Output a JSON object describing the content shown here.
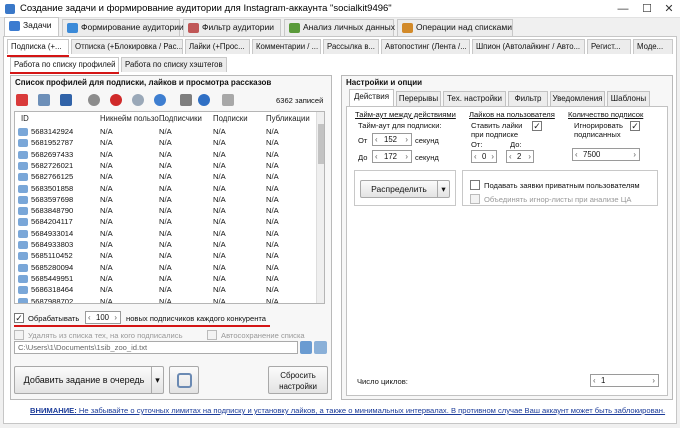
{
  "window": {
    "title": "Создание задачи и формирование аудитории для Instagram-аккаунта \"socialkit9496\"",
    "minimize": "—",
    "maximize": "☐",
    "close": "✕"
  },
  "main_tabs": [
    {
      "label": "Задачи",
      "icon": "tasks-icon",
      "color": "#3b7bd0"
    },
    {
      "label": "Формирование аудитории",
      "icon": "audience-icon",
      "color": "#3b8ad8"
    },
    {
      "label": "Фильтр аудитории",
      "icon": "filter-icon",
      "color": "#c05757"
    },
    {
      "label": "Анализ личных данных",
      "icon": "analysis-icon",
      "color": "#5a9a3a"
    },
    {
      "label": "Операции над списками",
      "icon": "lists-icon",
      "color": "#d28a2a"
    }
  ],
  "sub_tabs": [
    "Подписка (+...",
    "Отписка (+Блокировка / Рас...",
    "Лайки (+Прос...",
    "Комментарии / ...",
    "Рассылка в...",
    "Автопостинг (Лента /...",
    "Шпион (Автолайкинг / Авто...",
    "Регист...",
    "Моде..."
  ],
  "third_tabs": [
    "Работа по списку профилей",
    "Работа по списку хэштегов"
  ],
  "left": {
    "title": "Список профилей для подписки, лайков и просмотра рассказов",
    "count": "6362 записей",
    "columns": [
      "ID",
      "Никнейм пользо...",
      "Подписчики",
      "Подписки",
      "Публикации"
    ],
    "rows": [
      [
        "5683142924",
        "N/A",
        "N/A",
        "N/A",
        "N/A"
      ],
      [
        "5681952787",
        "N/A",
        "N/A",
        "N/A",
        "N/A"
      ],
      [
        "5682697433",
        "N/A",
        "N/A",
        "N/A",
        "N/A"
      ],
      [
        "5682726021",
        "N/A",
        "N/A",
        "N/A",
        "N/A"
      ],
      [
        "5682766125",
        "N/A",
        "N/A",
        "N/A",
        "N/A"
      ],
      [
        "5683501858",
        "N/A",
        "N/A",
        "N/A",
        "N/A"
      ],
      [
        "5683597698",
        "N/A",
        "N/A",
        "N/A",
        "N/A"
      ],
      [
        "5683848790",
        "N/A",
        "N/A",
        "N/A",
        "N/A"
      ],
      [
        "5684204117",
        "N/A",
        "N/A",
        "N/A",
        "N/A"
      ],
      [
        "5684933014",
        "N/A",
        "N/A",
        "N/A",
        "N/A"
      ],
      [
        "5684933803",
        "N/A",
        "N/A",
        "N/A",
        "N/A"
      ],
      [
        "5685110452",
        "N/A",
        "N/A",
        "N/A",
        "N/A"
      ],
      [
        "5685280094",
        "N/A",
        "N/A",
        "N/A",
        "N/A"
      ],
      [
        "5685449951",
        "N/A",
        "N/A",
        "N/A",
        "N/A"
      ],
      [
        "5686318464",
        "N/A",
        "N/A",
        "N/A",
        "N/A"
      ],
      [
        "5687988702",
        "N/A",
        "N/A",
        "N/A",
        "N/A"
      ]
    ],
    "process_label": "Обрабатывать",
    "process_value": "100",
    "process_suffix": "новых подписчиков каждого конкурента",
    "remove_label": "Удалять из списка тех, на кого подписались",
    "autosave_label": "Автосохранение списка",
    "path": "C:\\Users\\1\\Documents\\1sib_zoo_id.txt",
    "add_button": "Добавить задание в очередь",
    "reset_button_line1": "Сбросить",
    "reset_button_line2": "настройки"
  },
  "right": {
    "title": "Настройки и опции",
    "tabs": [
      "Действия",
      "Перерывы",
      "Тех. настройки",
      "Фильтр",
      "Уведомления",
      "Шаблоны"
    ],
    "timeout": {
      "title": "Тайм-аут между действиями",
      "sub": "Тайм-аут для подписки:",
      "from_label": "От",
      "from_value": "152",
      "to_label": "До",
      "to_value": "172",
      "unit": "секунд"
    },
    "likes": {
      "title": "Лайков на пользователя",
      "sub1": "Ставить лайки",
      "sub2": "при подписке",
      "from_label": "От:",
      "to_label": "До:",
      "from_value": "0",
      "to_value": "2"
    },
    "subs": {
      "title": "Количество подписок",
      "sub1": "Игнорировать",
      "sub2": "подписанных",
      "value": "7500"
    },
    "distribute_button": "Распределить",
    "private_label": "Подавать заявки приватным пользователям",
    "ignore_label": "Объединять игнор-листы при анализе ЦА",
    "cycles_label": "Число циклов:",
    "cycles_value": "1"
  },
  "warning": {
    "bold": "ВНИМАНИЕ:",
    "text": " Не забывайте о суточных лимитах на подписку и установку лайков, а также о минимальных интервалах. В противном случае Ваш аккаунт может быть заблокирован."
  }
}
